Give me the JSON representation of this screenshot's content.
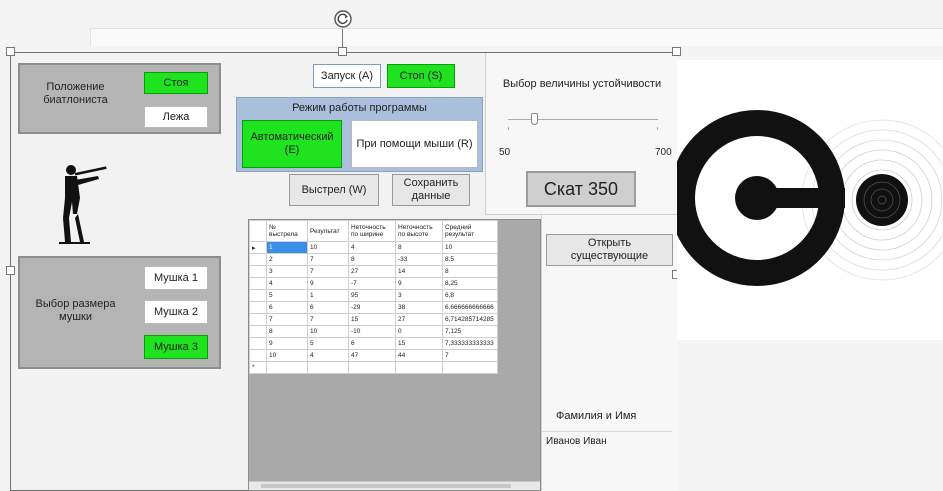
{
  "position_panel": {
    "title": "Положение биатлониста",
    "stand_label": "Стоя",
    "prone_label": "Лежа"
  },
  "sight_panel": {
    "title": "Выбор размера мушки",
    "options": [
      "Мушка 1",
      "Мушка 2",
      "Мушка 3"
    ]
  },
  "controls": {
    "start_label": "Запуск (A)",
    "stop_label": "Стоп (S)"
  },
  "mode_panel": {
    "title": "Режим работы программы",
    "auto_label": "Автоматический (E)",
    "mouse_label": "При помощи мыши (R)"
  },
  "actions": {
    "shot_label": "Выстрел (W)",
    "save_label": "Сохранить данные"
  },
  "stability": {
    "title": "Выбор величины устойчивости",
    "min": "50",
    "max": "700",
    "value_fraction": 0.17,
    "display": "Скат 350"
  },
  "open_existing_label": "Открыть существующие",
  "name_label": "Фамилия и Имя",
  "name_value": "Иванов Иван",
  "table": {
    "headers": [
      "№ выстрела",
      "Результат",
      "Неточность по ширине",
      "Неточность по высоте",
      "Средний результат"
    ],
    "rows": [
      [
        "1",
        "10",
        "4",
        "8",
        "10"
      ],
      [
        "2",
        "7",
        "8",
        "-33",
        "8.5"
      ],
      [
        "3",
        "7",
        "27",
        "14",
        "8"
      ],
      [
        "4",
        "9",
        "-7",
        "9",
        "8,25"
      ],
      [
        "5",
        "1",
        "95",
        "3",
        "6,8"
      ],
      [
        "6",
        "6",
        "-29",
        "38",
        "6,666666666666"
      ],
      [
        "7",
        "7",
        "15",
        "27",
        "6,714285714285"
      ],
      [
        "8",
        "10",
        "-10",
        "0",
        "7,125"
      ],
      [
        "9",
        "5",
        "6",
        "15",
        "7,333333333333"
      ],
      [
        "10",
        "4",
        "47",
        "44",
        "7"
      ]
    ]
  },
  "colors": {
    "active_green": "#1ee31e",
    "mode_panel_blue": "#a9bfdc",
    "panel_gray": "#b4b4b4"
  },
  "icons": {
    "rotate": "rotate-icon",
    "biathlete": "biathlete-silhouette-icon",
    "target": "target-icon"
  }
}
